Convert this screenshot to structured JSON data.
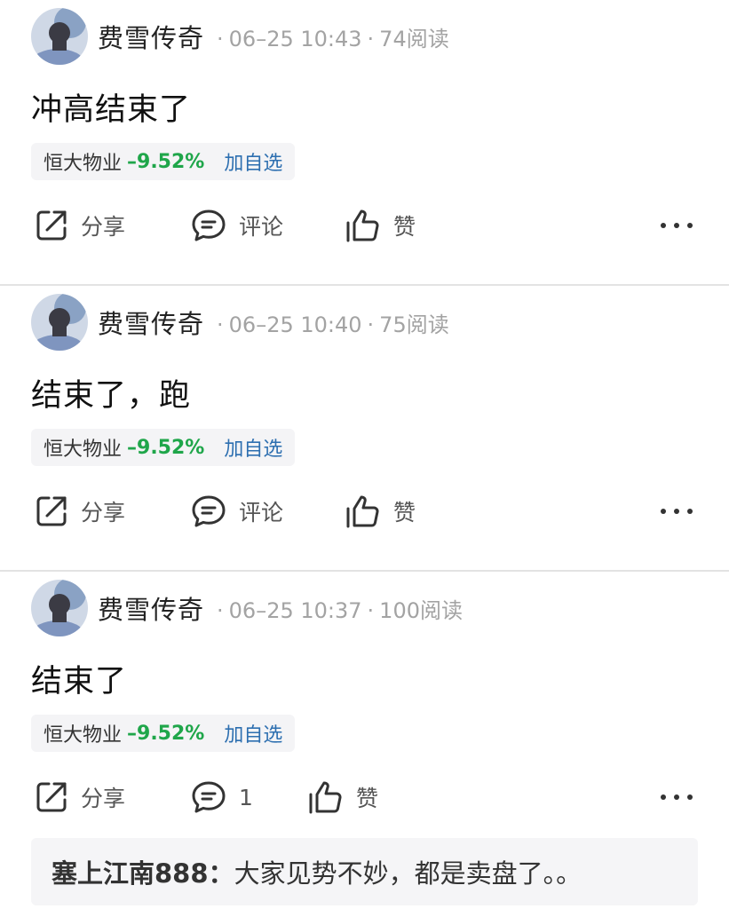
{
  "posts": [
    {
      "author": "费雪传奇",
      "time": "06–25 10:43",
      "reads": "74阅读",
      "content": "冲高结束了",
      "stock": {
        "name": "恒大物业",
        "change": "–9.52%",
        "add": "加自选"
      },
      "actions": {
        "share": "分享",
        "comment": "评论",
        "like": "赞"
      }
    },
    {
      "author": "费雪传奇",
      "time": "06–25 10:40",
      "reads": "75阅读",
      "content": "结束了，跑",
      "stock": {
        "name": "恒大物业",
        "change": "–9.52%",
        "add": "加自选"
      },
      "actions": {
        "share": "分享",
        "comment": "评论",
        "like": "赞"
      }
    },
    {
      "author": "费雪传奇",
      "time": "06–25 10:37",
      "reads": "100阅读",
      "content": "结束了",
      "stock": {
        "name": "恒大物业",
        "change": "–9.52%",
        "add": "加自选"
      },
      "actions": {
        "share": "分享",
        "comment": "1",
        "like": "赞"
      },
      "reply": {
        "user": "塞上江南888",
        "separator": "：",
        "text": "大家见势不妙，都是卖盘了。。"
      }
    }
  ],
  "meta_separator": "·",
  "icons": {
    "share": "share-icon",
    "comment": "comment-icon",
    "like": "thumbs-up-icon",
    "more": "more-dots-icon"
  },
  "colors": {
    "change_down": "#1fa64a",
    "link_blue": "#2d6fb0",
    "meta_gray": "#a3a3a3"
  }
}
